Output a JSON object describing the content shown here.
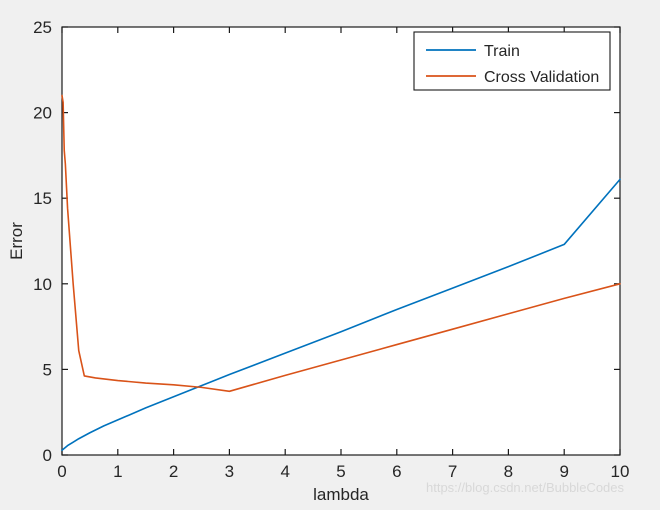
{
  "figure": {
    "background_color": "#f0f0f0",
    "plot_background_color": "#ffffff",
    "axis_color": "#1a1a1a"
  },
  "watermark": {
    "text": "https://blog.csdn.net/BubbleCodes",
    "color": "#d8d8d8"
  },
  "legend": {
    "position": "top-right",
    "entries": [
      {
        "label": "Train",
        "color": "#0072BD"
      },
      {
        "label": "Cross Validation",
        "color": "#D95319"
      }
    ]
  },
  "chart_data": {
    "type": "line",
    "title": "",
    "xlabel": "lambda",
    "ylabel": "Error",
    "xlim": [
      0,
      10
    ],
    "ylim": [
      0,
      25
    ],
    "xticks": [
      0,
      1,
      2,
      3,
      4,
      5,
      6,
      7,
      8,
      9,
      10
    ],
    "yticks": [
      0,
      5,
      10,
      15,
      20,
      25
    ],
    "xtick_labels": [
      "0",
      "1",
      "2",
      "3",
      "4",
      "5",
      "6",
      "7",
      "8",
      "9",
      "10"
    ],
    "ytick_labels": [
      "0",
      "5",
      "10",
      "15",
      "20",
      "25"
    ],
    "grid": false,
    "legend_position": "upper right",
    "series": [
      {
        "name": "Train",
        "color": "#0072BD",
        "x": [
          0,
          0.1,
          0.2,
          0.3,
          0.5,
          0.75,
          1,
          1.5,
          2,
          2.5,
          3,
          4,
          5,
          6,
          7,
          8,
          9,
          10
        ],
        "values": [
          0.28,
          0.55,
          0.75,
          0.95,
          1.3,
          1.7,
          2.05,
          2.75,
          3.4,
          4.05,
          4.7,
          5.95,
          7.2,
          8.5,
          9.75,
          11.0,
          12.3,
          16.1
        ]
      },
      {
        "name": "Cross Validation",
        "color": "#D95319",
        "x": [
          0,
          0.02,
          0.04,
          0.06,
          0.1,
          0.15,
          0.2,
          0.3,
          0.4,
          0.6,
          1,
          1.5,
          2,
          2.5,
          3,
          4,
          5,
          6,
          7,
          8,
          9,
          10
        ],
        "values": [
          21.0,
          20.6,
          17.8,
          17.0,
          14.4,
          12.2,
          10.0,
          6.1,
          4.62,
          4.5,
          4.35,
          4.2,
          4.1,
          3.95,
          3.72,
          4.65,
          5.55,
          6.45,
          7.35,
          8.25,
          9.15,
          10.0
        ]
      }
    ]
  }
}
